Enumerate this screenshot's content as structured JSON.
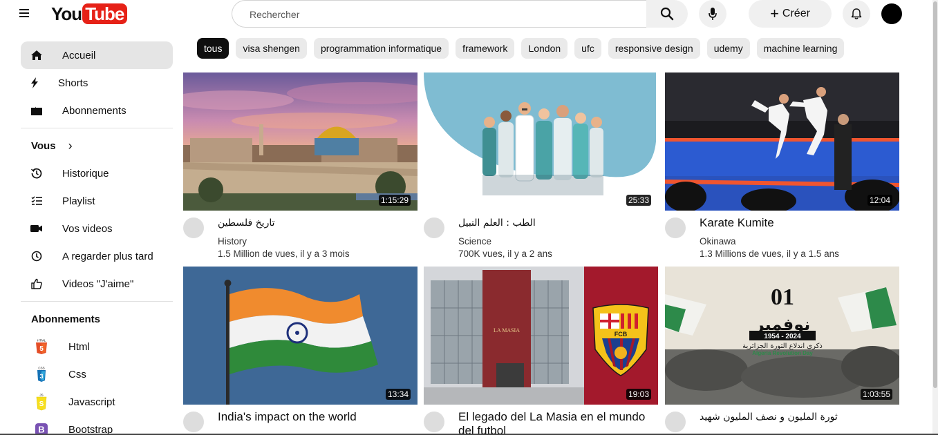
{
  "header": {
    "logo_you": "You",
    "logo_tube": "Tube",
    "search_placeholder": "Rechercher",
    "create_label": "Créer",
    "create_plus": "+"
  },
  "sidebar": {
    "main": [
      {
        "label": "Accueil",
        "icon": "home-icon"
      },
      {
        "label": "Shorts",
        "icon": "shorts-icon"
      },
      {
        "label": "Abonnements",
        "icon": "subscriptions-icon"
      }
    ],
    "you_heading": "Vous",
    "you_chevron": "›",
    "you_items": [
      {
        "label": "Historique",
        "icon": "history-icon"
      },
      {
        "label": "Playlist",
        "icon": "playlist-icon"
      },
      {
        "label": "Vos videos",
        "icon": "video-camera-icon"
      },
      {
        "label": "A regarder plus tard",
        "icon": "clock-icon"
      },
      {
        "label": "Videos \"J'aime\"",
        "icon": "thumbs-up-icon"
      }
    ],
    "subs_heading": "Abonnements",
    "subs": [
      {
        "label": "Html",
        "icon": "html5-icon",
        "color": "#e44d26"
      },
      {
        "label": "Css",
        "icon": "css3-icon",
        "color": "#1572b6"
      },
      {
        "label": "Javascript",
        "icon": "javascript-icon",
        "color": "#f7df1e"
      },
      {
        "label": "Bootstrap",
        "icon": "bootstrap-icon",
        "color": "#7952b3"
      }
    ]
  },
  "chips": [
    "tous",
    "visa shengen",
    "programmation informatique",
    "framework",
    "London",
    "ufc",
    "responsive design",
    "udemy",
    "machine learning"
  ],
  "videos": [
    {
      "title": "تاريخ فلسطين",
      "channel": "History",
      "meta": "1.5 Million de vues, il y a 3 mois",
      "duration": "1:15:29"
    },
    {
      "title": "الطب : العلم النبيل",
      "channel": "Science",
      "meta": "700K vues, il y a 2 ans",
      "duration": "25:33"
    },
    {
      "title": "Karate Kumite",
      "channel": "Okinawa",
      "meta": "1.3 Millions de vues, il y a 1.5 ans",
      "duration": "12:04"
    },
    {
      "title": "India's impact on the world",
      "channel": "",
      "meta": "",
      "duration": "13:34"
    },
    {
      "title": "El legado del La Masia en el mundo del futbol",
      "channel": "",
      "meta": "",
      "duration": "19:03"
    },
    {
      "title": "ثورة المليون و نصف المليون شهيد",
      "channel": "",
      "meta": "",
      "duration": "1:03:55"
    }
  ],
  "thumb_text": {
    "masia_sign": "LA MASIA",
    "fcb_letters": "FCB",
    "alg_number": "01",
    "alg_month": "نوفمبر",
    "alg_years": "1954 - 2024",
    "alg_subtitle": "ذكرى اندلاع الثورة الجزائرية",
    "alg_english": "Algeria Revolution Day"
  }
}
